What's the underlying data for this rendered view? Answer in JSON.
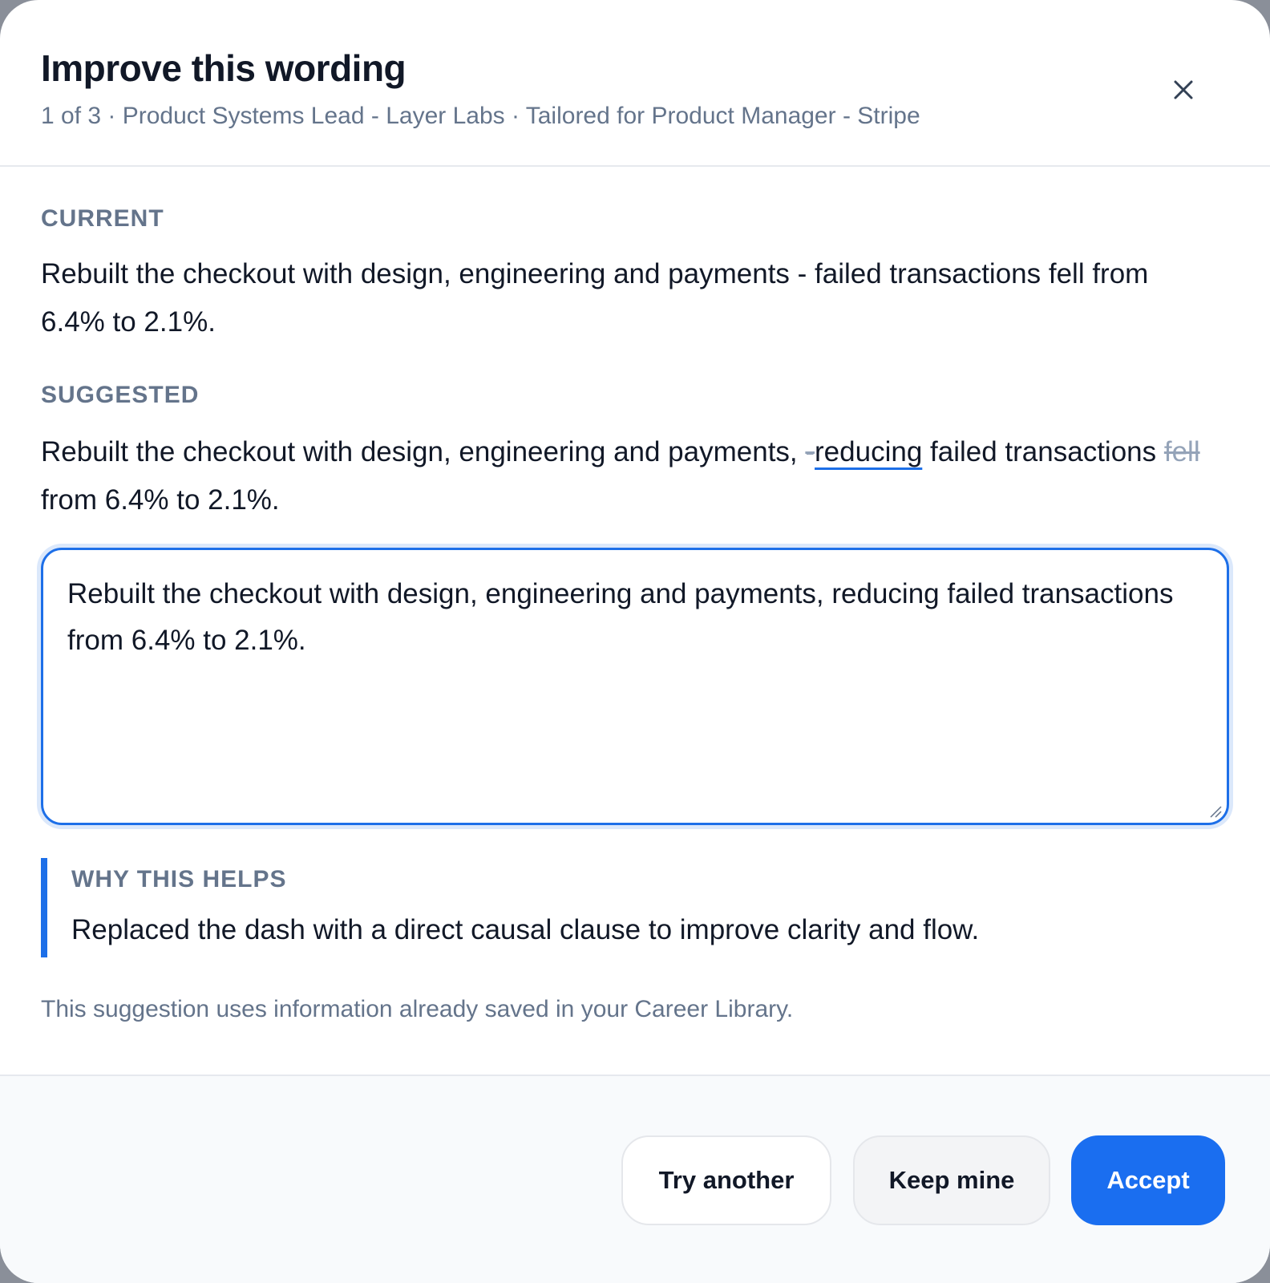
{
  "dialog": {
    "title": "Improve this wording",
    "subtitle": "1 of 3 · Product Systems Lead - Layer Labs · Tailored for Product Manager - Stripe",
    "close_icon": "close-icon"
  },
  "current": {
    "label": "CURRENT",
    "text": "Rebuilt the checkout with design, engineering and payments - failed transactions fell from 6.4% to 2.1%."
  },
  "suggested": {
    "label": "SUGGESTED",
    "part1": "Rebuilt the checkout with design, engineering and payments, ",
    "removed_dash": "-",
    "inserted": "reducing",
    "part2": " failed transactions ",
    "removed_word": "fell ",
    "part3": "from 6.4% to 2.1%."
  },
  "editor": {
    "value": "Rebuilt the checkout with design, engineering and payments, reducing failed transactions from 6.4% to 2.1%."
  },
  "why": {
    "label": "WHY THIS HELPS",
    "text": "Replaced the dash with a direct causal clause to improve clarity and flow."
  },
  "note": "This suggestion uses information already saved in your Career Library.",
  "buttons": {
    "try_another": "Try another",
    "keep_mine": "Keep mine",
    "accept": "Accept"
  },
  "colors": {
    "accent": "#1a6ef0",
    "muted": "#64748b"
  }
}
